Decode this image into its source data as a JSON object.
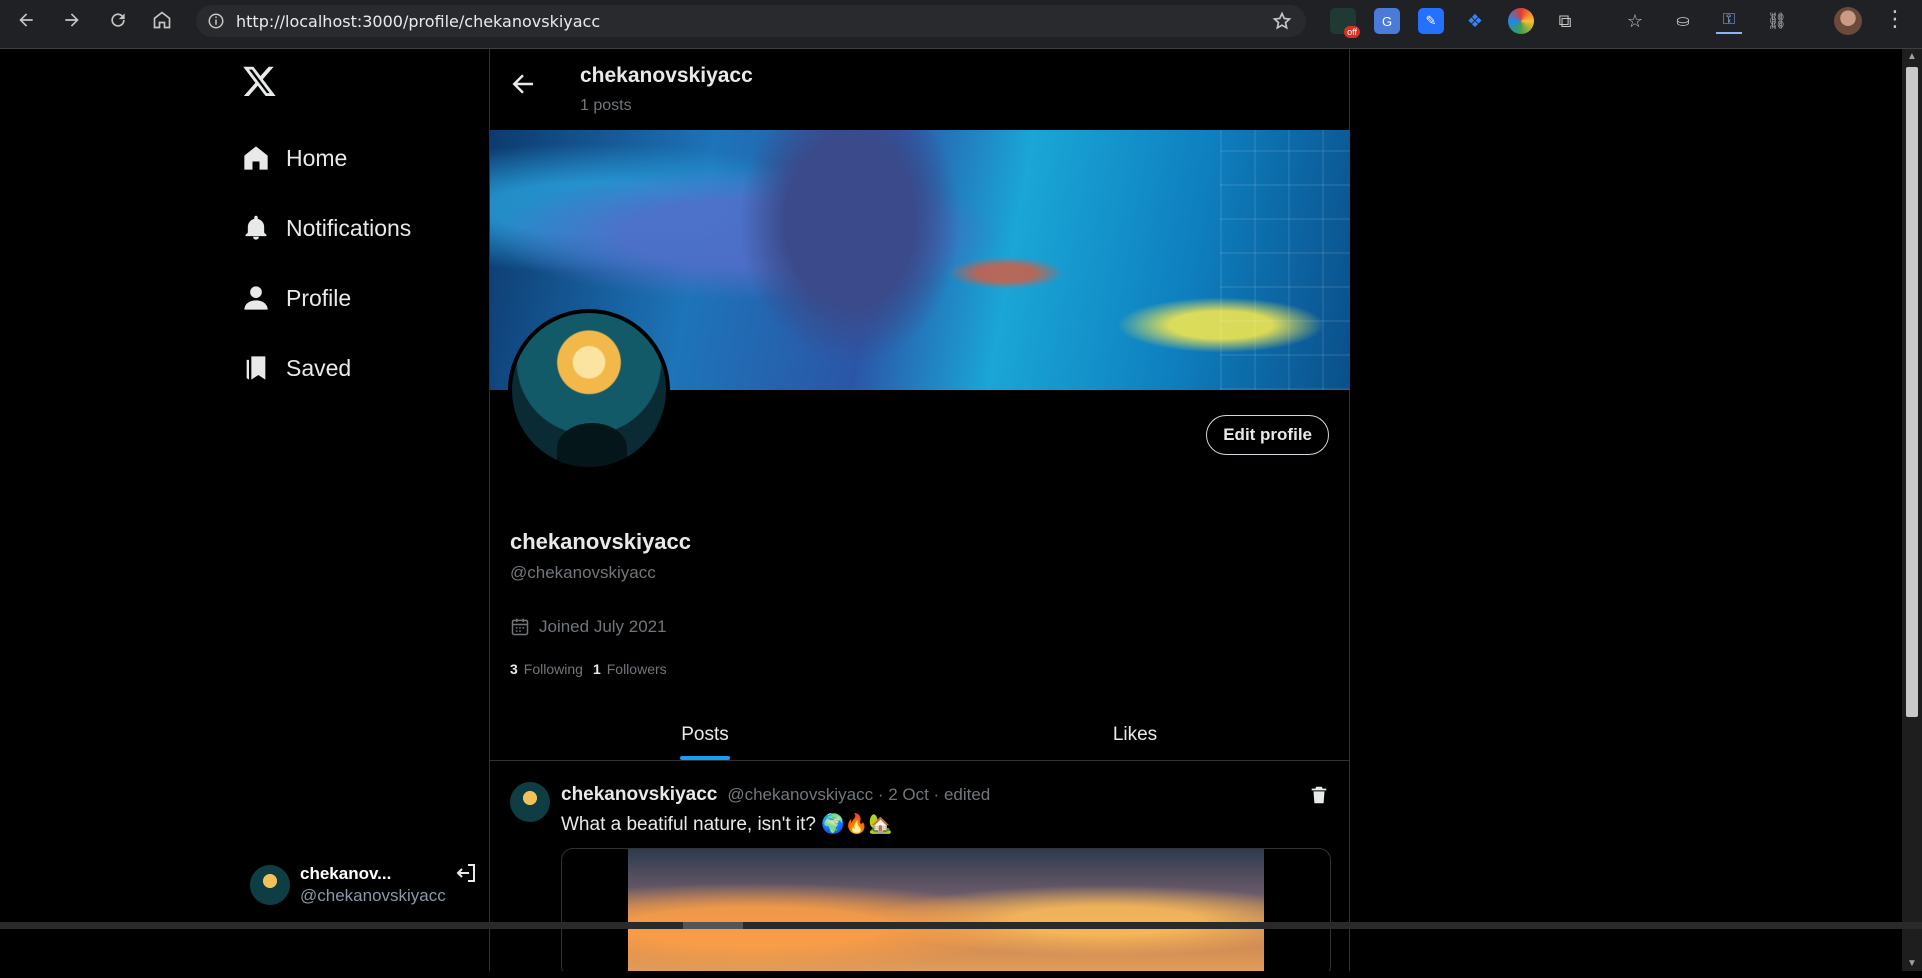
{
  "browser": {
    "url": "http://localhost:3000/profile/chekanovskiyacc",
    "ext_badge": "off"
  },
  "sidebar": {
    "items": [
      {
        "label": "Home",
        "icon": "home-icon"
      },
      {
        "label": "Notifications",
        "icon": "bell-icon"
      },
      {
        "label": "Profile",
        "icon": "person-icon"
      },
      {
        "label": "Saved",
        "icon": "bookmark-icon"
      }
    ],
    "user": {
      "name": "chekanov...",
      "handle": "@chekanovskiyacc"
    }
  },
  "header": {
    "title": "chekanovskiyacc",
    "post_count": "1 posts"
  },
  "profile": {
    "edit_label": "Edit profile",
    "name": "chekanovskiyacc",
    "handle": "@chekanovskiyacc",
    "joined": "Joined July 2021",
    "following_count": "3",
    "following_label": "Following",
    "followers_count": "1",
    "followers_label": "Followers"
  },
  "tabs": [
    {
      "label": "Posts",
      "active": true
    },
    {
      "label": "Likes",
      "active": false
    }
  ],
  "post": {
    "author": "chekanovskiyacc",
    "meta": "@chekanovskiyacc · 2 Oct · edited",
    "text": "What a beatiful nature, isn't it? 🌍🔥🏡"
  },
  "colors": {
    "accent": "#1d9bf0",
    "background": "#000000",
    "muted": "#71767b"
  }
}
